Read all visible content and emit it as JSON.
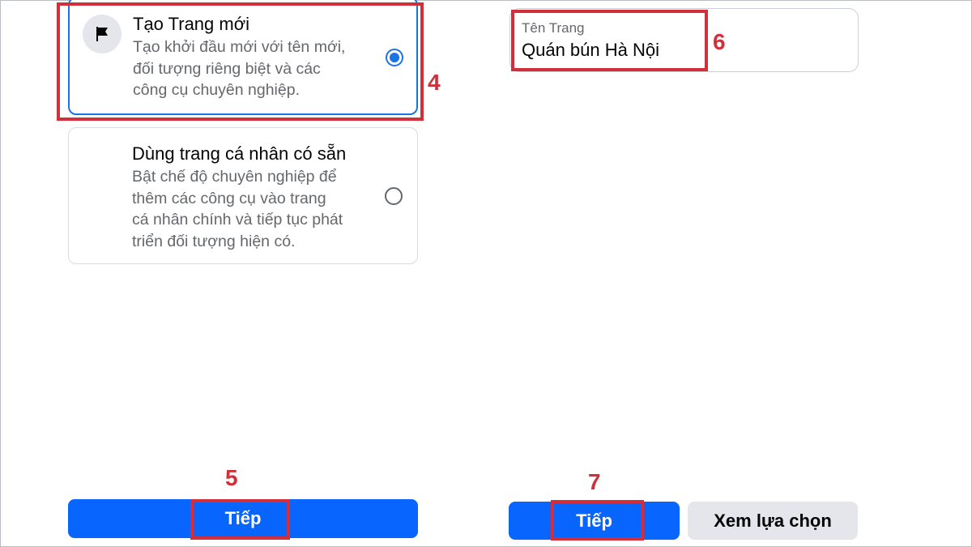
{
  "left_panel": {
    "option_new": {
      "icon": "flag-icon",
      "title": "Tạo Trang mới",
      "description": "Tạo khởi đầu mới với tên mới,\nđối tượng riêng biệt và các\ncông cụ chuyên nghiệp.",
      "selected": true
    },
    "option_existing": {
      "title": "Dùng trang cá nhân có sẵn",
      "description": "Bật chế độ chuyên nghiệp để\nthêm các công cụ vào trang\ncá nhân chính và tiếp tục phát\ntriển đối tượng hiện có.",
      "selected": false
    },
    "next_button": "Tiếp"
  },
  "right_panel": {
    "page_name_field": {
      "label": "Tên Trang",
      "value": "Quán bún Hà Nội"
    },
    "next_button": "Tiếp",
    "see_options_button": "Xem lựa chọn"
  },
  "step_markers": {
    "step4": "4",
    "step5": "5",
    "step6": "6",
    "step7": "7"
  },
  "colors": {
    "primary_blue": "#0866ff",
    "selection_blue": "#1b74e4",
    "highlight_red": "#d32f3a",
    "secondary_gray": "#e4e6eb"
  }
}
